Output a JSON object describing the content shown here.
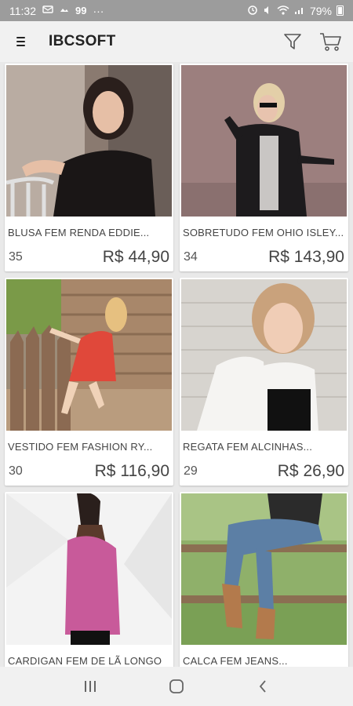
{
  "status_bar": {
    "time": "11:32",
    "notif_count": "99",
    "more": "···",
    "battery": "79%"
  },
  "app_bar": {
    "title": "IBCSOFT"
  },
  "products": [
    {
      "name": "BLUSA FEM RENDA EDDIE...",
      "code": "35",
      "price": "R$ 44,90"
    },
    {
      "name": "SOBRETUDO FEM OHIO ISLEY...",
      "code": "34",
      "price": "R$ 143,90"
    },
    {
      "name": "VESTIDO FEM FASHION RY...",
      "code": "30",
      "price": "R$ 116,90"
    },
    {
      "name": "REGATA FEM ALCINHAS...",
      "code": "29",
      "price": "R$ 26,90"
    },
    {
      "name": "CARDIGAN FEM DE LÃ LONGO",
      "code": "",
      "price": ""
    },
    {
      "name": "CALCA FEM JEANS...",
      "code": "",
      "price": ""
    }
  ],
  "colors": {
    "status_bar": "#9c9c9c",
    "app_bar": "#f1f1f1",
    "background": "#e9e9e9"
  }
}
